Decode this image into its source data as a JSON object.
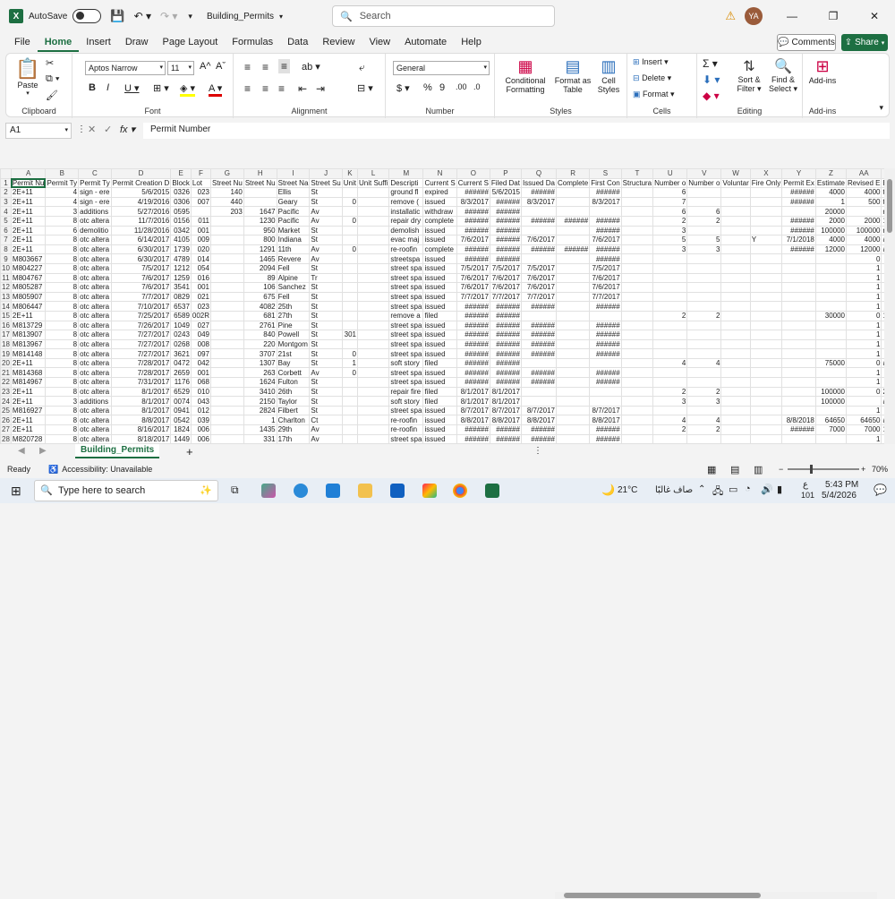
{
  "titlebar": {
    "autosave_label": "AutoSave",
    "filename": "Building_Permits",
    "search_placeholder": "Search",
    "avatar_initials": "YA",
    "minimize": "—",
    "restore": "❐",
    "close": "✕"
  },
  "menu": {
    "tabs": [
      "File",
      "Home",
      "Insert",
      "Draw",
      "Page Layout",
      "Formulas",
      "Data",
      "Review",
      "View",
      "Automate",
      "Help"
    ],
    "active": "Home",
    "comments": "Comments",
    "share": "Share"
  },
  "ribbon": {
    "clipboard": {
      "label": "Clipboard",
      "paste": "Paste"
    },
    "font": {
      "label": "Font",
      "name": "Aptos Narrow",
      "size": "11"
    },
    "alignment": {
      "label": "Alignment"
    },
    "number": {
      "label": "Number",
      "format": "General"
    },
    "styles": {
      "label": "Styles",
      "conditional": "Conditional",
      "formatting": "Formatting",
      "format_as": "Format as",
      "table": "Table",
      "cell": "Cell",
      "cell_styles": "Styles"
    },
    "cells": {
      "label": "Cells",
      "insert": "Insert",
      "delete": "Delete",
      "format": "Format"
    },
    "editing": {
      "label": "Editing",
      "sort": "Sort &",
      "filter": "Filter",
      "find": "Find &",
      "select": "Select"
    },
    "addins": {
      "label": "Add-ins",
      "btn1": "Add-ins",
      "btn2": "Add-ins"
    }
  },
  "formula": {
    "namebox": "A1",
    "content": "Permit Number"
  },
  "grid": {
    "columns": [
      "A",
      "B",
      "C",
      "D",
      "E",
      "F",
      "G",
      "H",
      "I",
      "J",
      "K",
      "L",
      "M",
      "N",
      "O",
      "P",
      "Q",
      "R",
      "S",
      "T",
      "U",
      "V",
      "W",
      "X",
      "Y",
      "Z",
      "AA",
      "AB"
    ],
    "header_row": [
      "Permit Nu",
      "Permit Ty",
      "Permit Ty",
      "Permit Creation D",
      "Block",
      "Lot",
      "Street Nu",
      "Street Nu",
      "Street Na",
      "Street Su",
      "Unit",
      "Unit Suffi",
      "Descripti",
      "Current S",
      "Current S",
      "Filed Dat",
      "Issued Da",
      "Complete",
      "First Con",
      "Structura",
      "Number o",
      "Number o",
      "Voluntar",
      "Fire Only",
      "Permit Ex",
      "Estimate",
      "Revised E",
      "Existing"
    ],
    "rows": [
      [
        "2E+11",
        "4",
        "sign - ere",
        "5/6/2015",
        "0326",
        "023",
        "140",
        "",
        "Ellis",
        "St",
        "",
        "",
        "ground fl",
        "expired",
        "######",
        "5/6/2015",
        "######",
        "",
        "######",
        "",
        "6",
        "",
        "",
        "",
        "######",
        "4000",
        "4000",
        "tourist h"
      ],
      [
        "2E+11",
        "4",
        "sign - ere",
        "4/19/2016",
        "0306",
        "007",
        "440",
        "",
        "Geary",
        "St",
        "0",
        "",
        "remove (",
        "issued",
        "8/3/2017",
        "######",
        "8/3/2017",
        "",
        "8/3/2017",
        "",
        "7",
        "",
        "",
        "",
        "######",
        "1",
        "500",
        "tourist h"
      ],
      [
        "2E+11",
        "3",
        "additions",
        "5/27/2016",
        "0595",
        "",
        "203",
        "1647",
        "Pacific",
        "Av",
        "",
        "",
        "installatic",
        "withdraw",
        "######",
        "######",
        "",
        "",
        "",
        "",
        "6",
        "6",
        "",
        "",
        "",
        "20000",
        "",
        "retail sa"
      ],
      [
        "2E+11",
        "8",
        "otc altera",
        "11/7/2016",
        "0156",
        "011",
        "",
        "1230",
        "Pacific",
        "Av",
        "0",
        "",
        "repair dry",
        "complete",
        "######",
        "######",
        "######",
        "######",
        "######",
        "",
        "2",
        "2",
        "",
        "",
        "######",
        "2000",
        "2000",
        "1 family"
      ],
      [
        "2E+11",
        "6",
        "demolitio",
        "11/28/2016",
        "0342",
        "001",
        "",
        "950",
        "Market",
        "St",
        "",
        "",
        "demolish",
        "issued",
        "######",
        "######",
        "",
        "",
        "######",
        "",
        "3",
        "",
        "",
        "",
        "######",
        "100000",
        "100000",
        "retail sa"
      ],
      [
        "2E+11",
        "8",
        "otc altera",
        "6/14/2017",
        "4105",
        "009",
        "",
        "800",
        "Indiana",
        "St",
        "",
        "",
        "evac maj",
        "issued",
        "7/6/2017",
        "######",
        "7/6/2017",
        "",
        "7/6/2017",
        "",
        "5",
        "5",
        "",
        "Y",
        "7/1/2018",
        "4000",
        "4000",
        "apartme"
      ],
      [
        "2E+11",
        "8",
        "otc altera",
        "6/30/2017",
        "1739",
        "020",
        "",
        "1291",
        "11th",
        "Av",
        "0",
        "",
        "re-roofin",
        "complete",
        "######",
        "######",
        "######",
        "######",
        "######",
        "",
        "3",
        "3",
        "",
        "",
        "######",
        "12000",
        "12000",
        "apartme"
      ],
      [
        "M803667",
        "8",
        "otc altera",
        "6/30/2017",
        "4789",
        "014",
        "",
        "1465",
        "Revere",
        "Av",
        "",
        "",
        "streetspa",
        "issued",
        "######",
        "######",
        "",
        "",
        "######",
        "",
        "",
        "",
        "",
        "",
        "",
        "",
        "0",
        ""
      ],
      [
        "M804227",
        "8",
        "otc altera",
        "7/5/2017",
        "1212",
        "054",
        "",
        "2094",
        "Fell",
        "St",
        "",
        "",
        "street spa",
        "issued",
        "7/5/2017",
        "7/5/2017",
        "7/5/2017",
        "",
        "7/5/2017",
        "",
        "",
        "",
        "",
        "",
        "",
        "",
        "1",
        ""
      ],
      [
        "M804767",
        "8",
        "otc altera",
        "7/6/2017",
        "1259",
        "016",
        "",
        "89",
        "Alpine",
        "Tr",
        "",
        "",
        "street spa",
        "issued",
        "7/6/2017",
        "7/6/2017",
        "7/6/2017",
        "",
        "7/6/2017",
        "",
        "",
        "",
        "",
        "",
        "",
        "",
        "1",
        ""
      ],
      [
        "M805287",
        "8",
        "otc altera",
        "7/6/2017",
        "3541",
        "001",
        "",
        "106",
        "Sanchez",
        "St",
        "",
        "",
        "street spa",
        "issued",
        "7/6/2017",
        "7/6/2017",
        "7/6/2017",
        "",
        "7/6/2017",
        "",
        "",
        "",
        "",
        "",
        "",
        "",
        "1",
        ""
      ],
      [
        "M805907",
        "8",
        "otc altera",
        "7/7/2017",
        "0829",
        "021",
        "",
        "675",
        "Fell",
        "St",
        "",
        "",
        "street spa",
        "issued",
        "7/7/2017",
        "7/7/2017",
        "7/7/2017",
        "",
        "7/7/2017",
        "",
        "",
        "",
        "",
        "",
        "",
        "",
        "1",
        ""
      ],
      [
        "M806447",
        "8",
        "otc altera",
        "7/10/2017",
        "6537",
        "023",
        "",
        "4082",
        "25th",
        "St",
        "",
        "",
        "street spa",
        "issued",
        "######",
        "######",
        "######",
        "",
        "######",
        "",
        "",
        "",
        "",
        "",
        "",
        "",
        "1",
        ""
      ],
      [
        "2E+11",
        "8",
        "otc altera",
        "7/25/2017",
        "6589",
        "002R",
        "",
        "681",
        "27th",
        "St",
        "",
        "",
        "remove a",
        "filed",
        "######",
        "######",
        "",
        "",
        "",
        "",
        "2",
        "2",
        "",
        "",
        "",
        "30000",
        "0",
        "1 family"
      ],
      [
        "M813729",
        "8",
        "otc altera",
        "7/26/2017",
        "1049",
        "027",
        "",
        "2761",
        "Pine",
        "St",
        "",
        "",
        "street spa",
        "issued",
        "######",
        "######",
        "######",
        "",
        "######",
        "",
        "",
        "",
        "",
        "",
        "",
        "",
        "1",
        ""
      ],
      [
        "M813907",
        "8",
        "otc altera",
        "7/27/2017",
        "0243",
        "049",
        "",
        "840",
        "Powell",
        "St",
        "301",
        "",
        "street spa",
        "issued",
        "######",
        "######",
        "######",
        "",
        "######",
        "",
        "",
        "",
        "",
        "",
        "",
        "",
        "1",
        ""
      ],
      [
        "M813967",
        "8",
        "otc altera",
        "7/27/2017",
        "0268",
        "008",
        "",
        "220",
        "Montgom",
        "St",
        "",
        "",
        "street spa",
        "issued",
        "######",
        "######",
        "######",
        "",
        "######",
        "",
        "",
        "",
        "",
        "",
        "",
        "",
        "1",
        ""
      ],
      [
        "M814148",
        "8",
        "otc altera",
        "7/27/2017",
        "3621",
        "097",
        "",
        "3707",
        "21st",
        "St",
        "0",
        "",
        "street spa",
        "issued",
        "######",
        "######",
        "######",
        "",
        "######",
        "",
        "",
        "",
        "",
        "",
        "",
        "",
        "1",
        ""
      ],
      [
        "2E+11",
        "8",
        "otc altera",
        "7/28/2017",
        "0472",
        "042",
        "",
        "1307",
        "Bay",
        "St",
        "1",
        "",
        "soft story",
        "filed",
        "######",
        "######",
        "",
        "",
        "",
        "",
        "4",
        "4",
        "",
        "",
        "",
        "75000",
        "0",
        "apartme"
      ],
      [
        "M814368",
        "8",
        "otc altera",
        "7/28/2017",
        "2659",
        "001",
        "",
        "263",
        "Corbett",
        "Av",
        "0",
        "",
        "street spa",
        "issued",
        "######",
        "######",
        "######",
        "",
        "######",
        "",
        "",
        "",
        "",
        "",
        "",
        "",
        "1",
        ""
      ],
      [
        "M814967",
        "8",
        "otc altera",
        "7/31/2017",
        "1176",
        "068",
        "",
        "1624",
        "Fulton",
        "St",
        "",
        "",
        "street spa",
        "issued",
        "######",
        "######",
        "######",
        "",
        "######",
        "",
        "",
        "",
        "",
        "",
        "",
        "",
        "1",
        ""
      ],
      [
        "2E+11",
        "8",
        "otc altera",
        "8/1/2017",
        "6529",
        "010",
        "",
        "3410",
        "26th",
        "St",
        "",
        "",
        "repair fire",
        "filed",
        "8/1/2017",
        "8/1/2017",
        "",
        "",
        "",
        "",
        "2",
        "2",
        "",
        "",
        "",
        "100000",
        "0",
        "2 family"
      ],
      [
        "2E+11",
        "3",
        "additions",
        "8/1/2017",
        "0074",
        "043",
        "",
        "2150",
        "Taylor",
        "St",
        "",
        "",
        "soft story",
        "filed",
        "8/1/2017",
        "8/1/2017",
        "",
        "",
        "",
        "",
        "3",
        "3",
        "",
        "",
        "",
        "100000",
        "",
        "apartme"
      ],
      [
        "M816927",
        "8",
        "otc altera",
        "8/1/2017",
        "0941",
        "012",
        "",
        "2824",
        "Filbert",
        "St",
        "",
        "",
        "street spa",
        "issued",
        "8/7/2017",
        "8/7/2017",
        "8/7/2017",
        "",
        "8/7/2017",
        "",
        "",
        "",
        "",
        "",
        "",
        "",
        "1",
        ""
      ],
      [
        "2E+11",
        "8",
        "otc altera",
        "8/8/2017",
        "0542",
        "039",
        "",
        "1",
        "Charlton",
        "Ct",
        "",
        "",
        "re-roofin",
        "issued",
        "8/8/2017",
        "8/8/2017",
        "8/8/2017",
        "",
        "8/8/2017",
        "",
        "4",
        "4",
        "",
        "",
        "8/8/2018",
        "64650",
        "64650",
        "apartme"
      ],
      [
        "2E+11",
        "8",
        "otc altera",
        "8/16/2017",
        "1824",
        "006",
        "",
        "1435",
        "29th",
        "Av",
        "",
        "",
        "re-roofin",
        "issued",
        "######",
        "######",
        "######",
        "",
        "######",
        "",
        "2",
        "2",
        "",
        "",
        "######",
        "7000",
        "7000",
        "1 family"
      ],
      [
        "M820728",
        "8",
        "otc altera",
        "8/18/2017",
        "1449",
        "006",
        "",
        "331",
        "17th",
        "Av",
        "",
        "",
        "street spa",
        "issued",
        "######",
        "######",
        "######",
        "",
        "######",
        "",
        "",
        "",
        "",
        "",
        "",
        "",
        "1",
        ""
      ],
      [
        "M821207",
        "8",
        "otc altera",
        "8/21/2017",
        "1193",
        "024",
        "",
        "120",
        "Shrader",
        "St",
        "",
        "",
        "street spa",
        "issued",
        "######",
        "######",
        "######",
        "",
        "######",
        "",
        "",
        "",
        "",
        "",
        "",
        "",
        "1",
        ""
      ]
    ]
  },
  "sheet": {
    "tab": "Building_Permits",
    "add": "+"
  },
  "status": {
    "ready": "Ready",
    "accessibility": "Accessibility: Unavailable",
    "zoom": "70%"
  },
  "taskbar": {
    "search": "Type here to search",
    "weather": "21°C",
    "weather_text": "صاف غالبًا",
    "time": "5:43 PM",
    "date": "5/4/2026",
    "lang": "ع",
    "badge": "101"
  }
}
